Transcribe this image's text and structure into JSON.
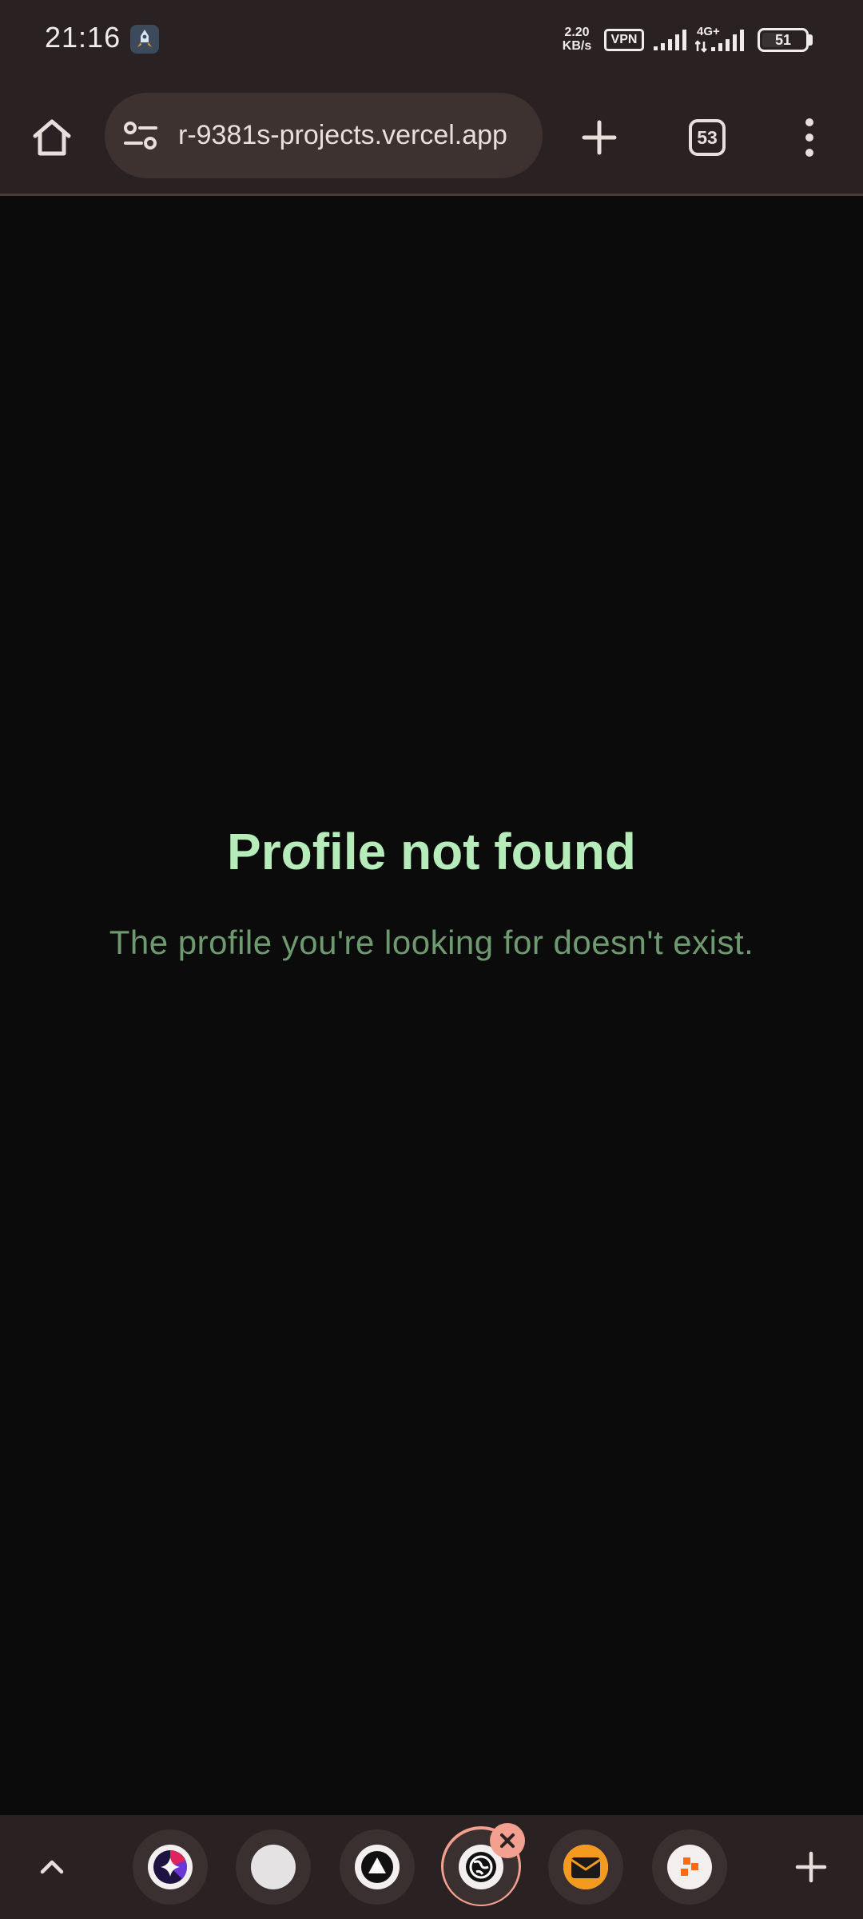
{
  "status_bar": {
    "time": "21:16",
    "net_speed_value": "2.20",
    "net_speed_unit": "KB/s",
    "vpn_label": "VPN",
    "network_type": "4G+",
    "battery_percent": "51",
    "battery_level": 0.51
  },
  "toolbar": {
    "url_text": "r-9381s-projects.vercel.app",
    "tab_count": "53"
  },
  "page": {
    "title": "Profile not found",
    "message": "The profile you're looking for doesn't exist."
  },
  "bottom_tabs": {
    "tabs": [
      {
        "icon": "gemini-sparkle-icon",
        "active": false
      },
      {
        "icon": "blank-favicon-icon",
        "active": false
      },
      {
        "icon": "triangle-logo-icon",
        "active": false
      },
      {
        "icon": "globe-icon",
        "active": true
      },
      {
        "icon": "mail-icon",
        "active": false
      },
      {
        "icon": "orange-tiles-icon",
        "active": false
      }
    ]
  },
  "colors": {
    "chrome_background": "#2a2222",
    "page_background": "#0b0b0b",
    "title_green": "#b5ecb9",
    "message_green": "#6e9a70",
    "active_tab_accent": "#f4a090"
  }
}
